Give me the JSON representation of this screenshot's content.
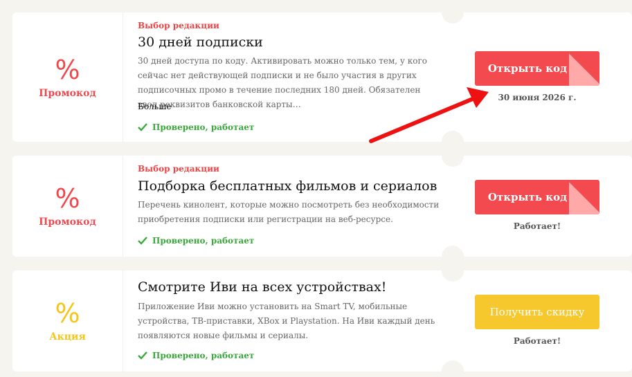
{
  "coupons": [
    {
      "badge_symbol": "%",
      "badge_type": "Промокод",
      "editors_pick": "Выбор редакции",
      "title": "30 дней подписки",
      "description": "30 дней доступа по коду. Активировать можно только тем, у кого сейчас нет действующей подписки и не было участия в других подписочных промо в течение последних 180 дней. Обязателен ввод реквизитов банковской карты…",
      "more_label": "Больше",
      "verified_label": "Проверено, работает",
      "button_label": "Открыть код",
      "note": "30 июня 2026 г."
    },
    {
      "badge_symbol": "%",
      "badge_type": "Промокод",
      "editors_pick": "Выбор редакции",
      "title": "Подборка бесплатных фильмов и сериалов",
      "description": "Перечень кинолент, которые можно посмотреть без необходимости приобретения подписки или регистрации на веб-ресурсе.",
      "verified_label": "Проверено, работает",
      "button_label": "Открыть код",
      "note": "Работает!"
    },
    {
      "badge_symbol": "%",
      "badge_type": "Акция",
      "title": "Смотрите Иви на всех устройствах!",
      "description": "Приложение Иви можно установить на Smart TV, мобильные устройства, ТВ-приставки, XBox и Playstation. На Иви каждый день появляются новые фильмы и сериалы.",
      "verified_label": "Проверено, работает",
      "button_label": "Получить скидку",
      "note": "Работает!"
    }
  ],
  "colors": {
    "accent_red": "#f24a4e",
    "accent_yellow": "#f6c82d",
    "verified_green": "#3aa83a",
    "annotation_arrow": "#ee1111"
  },
  "icons": {
    "verified": "check-icon",
    "annotation": "red-arrow-icon"
  }
}
